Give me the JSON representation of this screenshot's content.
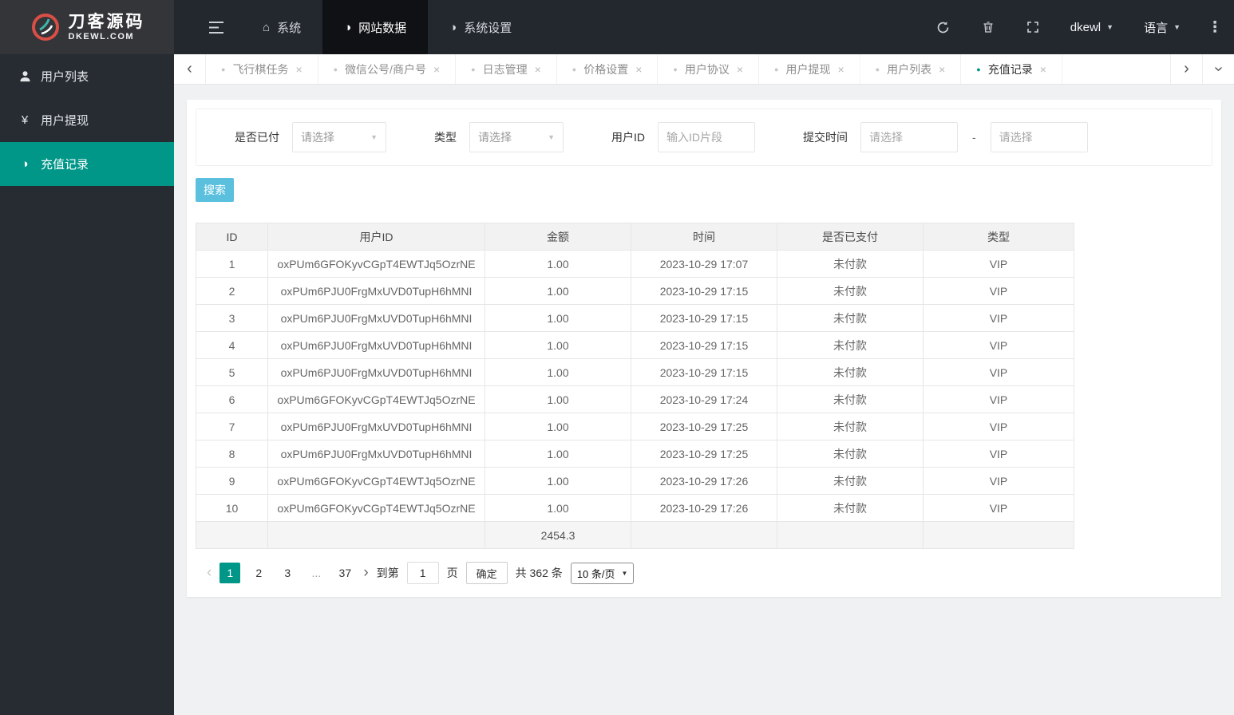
{
  "brand": {
    "title": "刀客源码",
    "subtitle": "DKEWL.COM"
  },
  "topnav": {
    "items": [
      {
        "label": "系统",
        "icon": "home-icon",
        "active": false
      },
      {
        "label": "网站数据",
        "icon": "data-icon",
        "active": true
      },
      {
        "label": "系统设置",
        "icon": "settings-icon",
        "active": false
      }
    ],
    "username": "dkewl",
    "language_label": "语言"
  },
  "sidebar": {
    "items": [
      {
        "label": "用户列表",
        "icon": "user-icon",
        "active": false
      },
      {
        "label": "用户提现",
        "icon": "yen-icon",
        "active": false
      },
      {
        "label": "充值记录",
        "icon": "record-icon",
        "active": true
      }
    ]
  },
  "tabs": {
    "items": [
      {
        "label": "飞行棋任务",
        "active": false
      },
      {
        "label": "微信公号/商户号",
        "active": false
      },
      {
        "label": "日志管理",
        "active": false
      },
      {
        "label": "价格设置",
        "active": false
      },
      {
        "label": "用户协议",
        "active": false
      },
      {
        "label": "用户提现",
        "active": false
      },
      {
        "label": "用户列表",
        "active": false
      },
      {
        "label": "充值记录",
        "active": true
      }
    ]
  },
  "filters": {
    "paid_label": "是否已付",
    "paid_placeholder": "请选择",
    "type_label": "类型",
    "type_placeholder": "请选择",
    "userid_label": "用户ID",
    "userid_placeholder": "输入ID片段",
    "time_label": "提交时间",
    "time_from_placeholder": "请选择",
    "time_to_placeholder": "请选择",
    "range_separator": "-",
    "search_label": "搜索"
  },
  "table": {
    "headers": [
      "ID",
      "用户ID",
      "金额",
      "时间",
      "是否已支付",
      "类型"
    ],
    "rows": [
      [
        "1",
        "oxPUm6GFOKyvCGpT4EWTJq5OzrNE",
        "1.00",
        "2023-10-29 17:07",
        "未付款",
        "VIP"
      ],
      [
        "2",
        "oxPUm6PJU0FrgMxUVD0TupH6hMNI",
        "1.00",
        "2023-10-29 17:15",
        "未付款",
        "VIP"
      ],
      [
        "3",
        "oxPUm6PJU0FrgMxUVD0TupH6hMNI",
        "1.00",
        "2023-10-29 17:15",
        "未付款",
        "VIP"
      ],
      [
        "4",
        "oxPUm6PJU0FrgMxUVD0TupH6hMNI",
        "1.00",
        "2023-10-29 17:15",
        "未付款",
        "VIP"
      ],
      [
        "5",
        "oxPUm6PJU0FrgMxUVD0TupH6hMNI",
        "1.00",
        "2023-10-29 17:15",
        "未付款",
        "VIP"
      ],
      [
        "6",
        "oxPUm6GFOKyvCGpT4EWTJq5OzrNE",
        "1.00",
        "2023-10-29 17:24",
        "未付款",
        "VIP"
      ],
      [
        "7",
        "oxPUm6PJU0FrgMxUVD0TupH6hMNI",
        "1.00",
        "2023-10-29 17:25",
        "未付款",
        "VIP"
      ],
      [
        "8",
        "oxPUm6PJU0FrgMxUVD0TupH6hMNI",
        "1.00",
        "2023-10-29 17:25",
        "未付款",
        "VIP"
      ],
      [
        "9",
        "oxPUm6GFOKyvCGpT4EWTJq5OzrNE",
        "1.00",
        "2023-10-29 17:26",
        "未付款",
        "VIP"
      ],
      [
        "10",
        "oxPUm6GFOKyvCGpT4EWTJq5OzrNE",
        "1.00",
        "2023-10-29 17:26",
        "未付款",
        "VIP"
      ]
    ],
    "total_amount": "2454.3"
  },
  "pagination": {
    "pages": [
      "1",
      "2",
      "3",
      "...",
      "37"
    ],
    "active_page": "1",
    "goto_label": "到第",
    "goto_value": "1",
    "page_unit": "页",
    "confirm_label": "确定",
    "total_text": "共 362 条",
    "page_size": "10 条/页"
  },
  "colors": {
    "accent": "#009688",
    "search_button": "#5bc0de"
  }
}
